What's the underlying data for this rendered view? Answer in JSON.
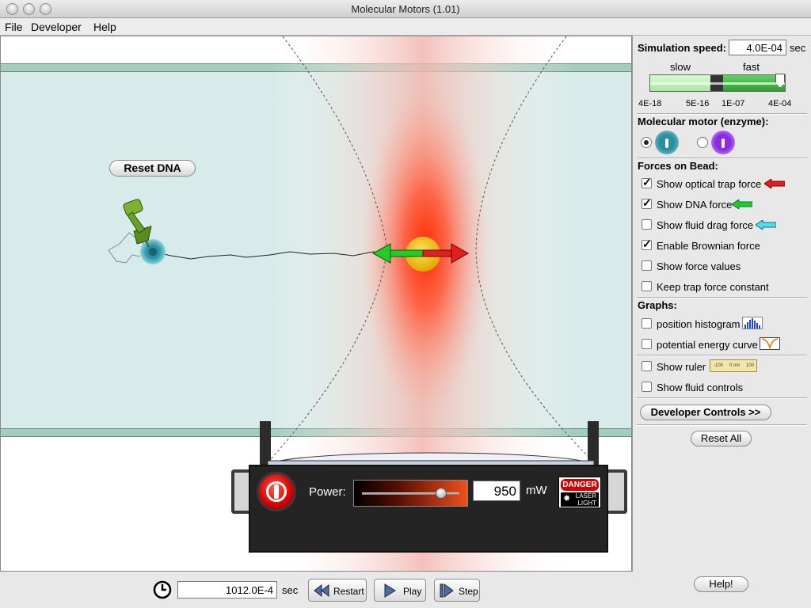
{
  "window": {
    "title": "Molecular Motors (1.01)"
  },
  "menu": {
    "file": "File",
    "developer": "Developer",
    "help": "Help"
  },
  "play_area": {
    "reset_dna_label": "Reset DNA",
    "laser": {
      "power_label": "Power:",
      "power_value": "950",
      "power_unit": "mW",
      "power_fraction": 0.84,
      "danger_label": "DANGER",
      "laser_label_1": "LASER",
      "laser_label_2": "LIGHT"
    }
  },
  "panel": {
    "sim_speed_label": "Simulation speed:",
    "sim_speed_value": "4.0E-04",
    "sim_speed_unit": "sec",
    "speed_slow": "slow",
    "speed_fast": "fast",
    "speed_ticks": [
      "4E-18",
      "5E-16",
      "1E-07",
      "4E-04"
    ],
    "motor_title": "Molecular motor (enzyme):",
    "motor_selected": "teal",
    "forces_title": "Forces on Bead:",
    "forces": [
      {
        "label": "Show optical trap force",
        "checked": true
      },
      {
        "label": "Show DNA force",
        "checked": true
      },
      {
        "label": "Show fluid drag force",
        "checked": false
      },
      {
        "label": "Enable Brownian force",
        "checked": true
      },
      {
        "label": "Show force values",
        "checked": false
      },
      {
        "label": "Keep trap force constant",
        "checked": false
      }
    ],
    "graphs_title": "Graphs:",
    "graphs": [
      {
        "label": "position histogram",
        "checked": false
      },
      {
        "label": "potential energy curve",
        "checked": false
      }
    ],
    "extras": [
      {
        "label": "Show ruler",
        "checked": false
      },
      {
        "label": "Show fluid controls",
        "checked": false
      }
    ],
    "ruler_ticks": [
      "-100",
      "0 nm",
      "100"
    ],
    "developer_controls_label": "Developer Controls >>",
    "reset_all_label": "Reset All"
  },
  "footer": {
    "time_value": "1012.0E-4",
    "time_unit": "sec",
    "restart_label": "Restart",
    "play_label": "Play",
    "step_label": "Step",
    "help_label": "Help!"
  },
  "colors": {
    "channel": "#d7ecea",
    "trap_force": "#e02020",
    "dna_force": "#22cc22",
    "drag_force": "#55ddee",
    "speed_bar": "#44c044"
  }
}
